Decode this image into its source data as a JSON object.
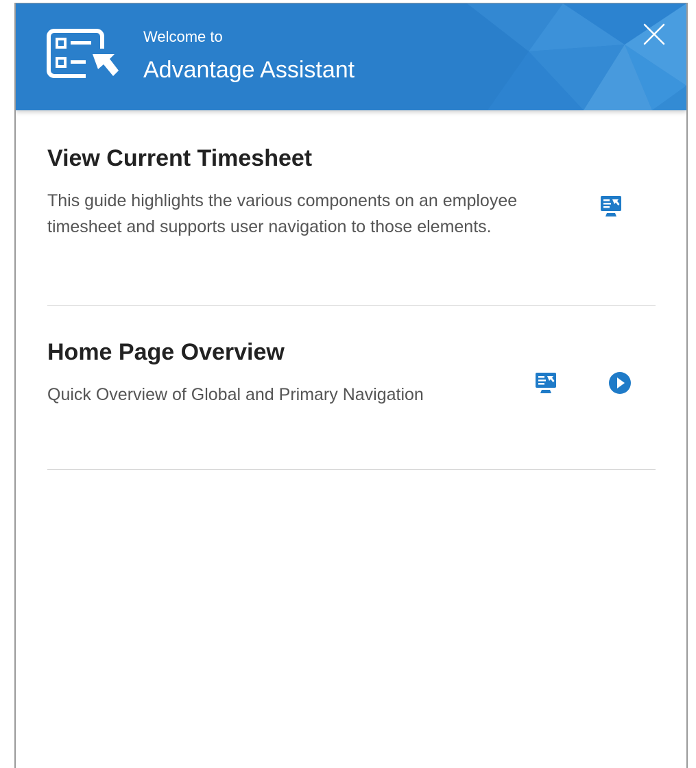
{
  "header": {
    "kicker": "Welcome to",
    "title": "Advantage Assistant"
  },
  "guides": [
    {
      "title": "View Current Timesheet",
      "description": "This guide highlights the various components on an employee timesheet and supports user navigation to those elements.",
      "icon": "guide-screen-icon"
    },
    {
      "title": "Home Page Overview",
      "description": "Quick Overview of Global and Primary Navigation",
      "icon": "guide-screen-icon",
      "action_icon": "play-circle-icon"
    }
  ],
  "colors": {
    "header_blue": "#2a7fcb",
    "accent_blue": "#1f7bc8",
    "title_text": "#222222",
    "body_text": "#555555",
    "divider": "#d4d4d4"
  }
}
